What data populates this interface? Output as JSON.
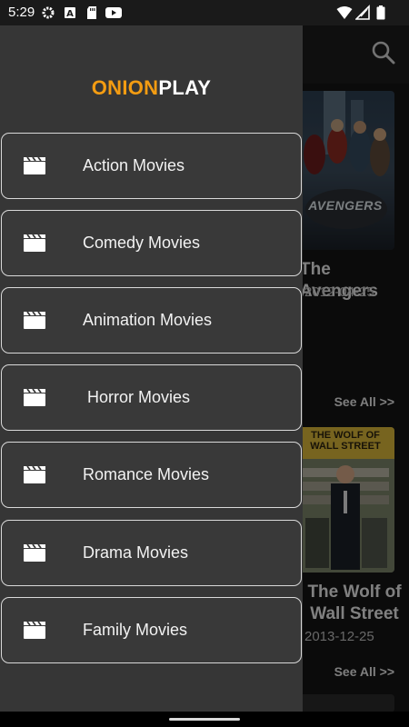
{
  "status_bar": {
    "time": "5:29",
    "left_icons": [
      "settings-icon",
      "font-a-icon",
      "sd-card-icon",
      "youtube-icon"
    ],
    "right_icons": [
      "wifi-icon",
      "cellular-signal-icon",
      "battery-icon"
    ]
  },
  "drawer": {
    "brand_part1": "ONION",
    "brand_part2": "PLAY",
    "brand_color": "#f39c12",
    "items": [
      {
        "label": "Action Movies",
        "icon": "clapperboard-icon"
      },
      {
        "label": "Comedy Movies",
        "icon": "clapperboard-icon"
      },
      {
        "label": "Animation Movies",
        "icon": "clapperboard-icon"
      },
      {
        "label": " Horror Movies",
        "icon": "clapperboard-icon"
      },
      {
        "label": "Romance Movies",
        "icon": "clapperboard-icon"
      },
      {
        "label": "Drama Movies",
        "icon": "clapperboard-icon"
      },
      {
        "label": "Family Movies",
        "icon": "clapperboard-icon"
      }
    ]
  },
  "background": {
    "search_icon": "search-icon",
    "movies": [
      {
        "title": "The Avengers",
        "date": "2012-04-25",
        "poster_text": "AVENGERS"
      },
      {
        "title": "The Wolf of Wall Street",
        "date": "2013-12-25",
        "poster_text": "THE WOLF OF WALL STREET"
      }
    ],
    "see_all_1": "See All >>",
    "see_all_2": "See All >>"
  }
}
